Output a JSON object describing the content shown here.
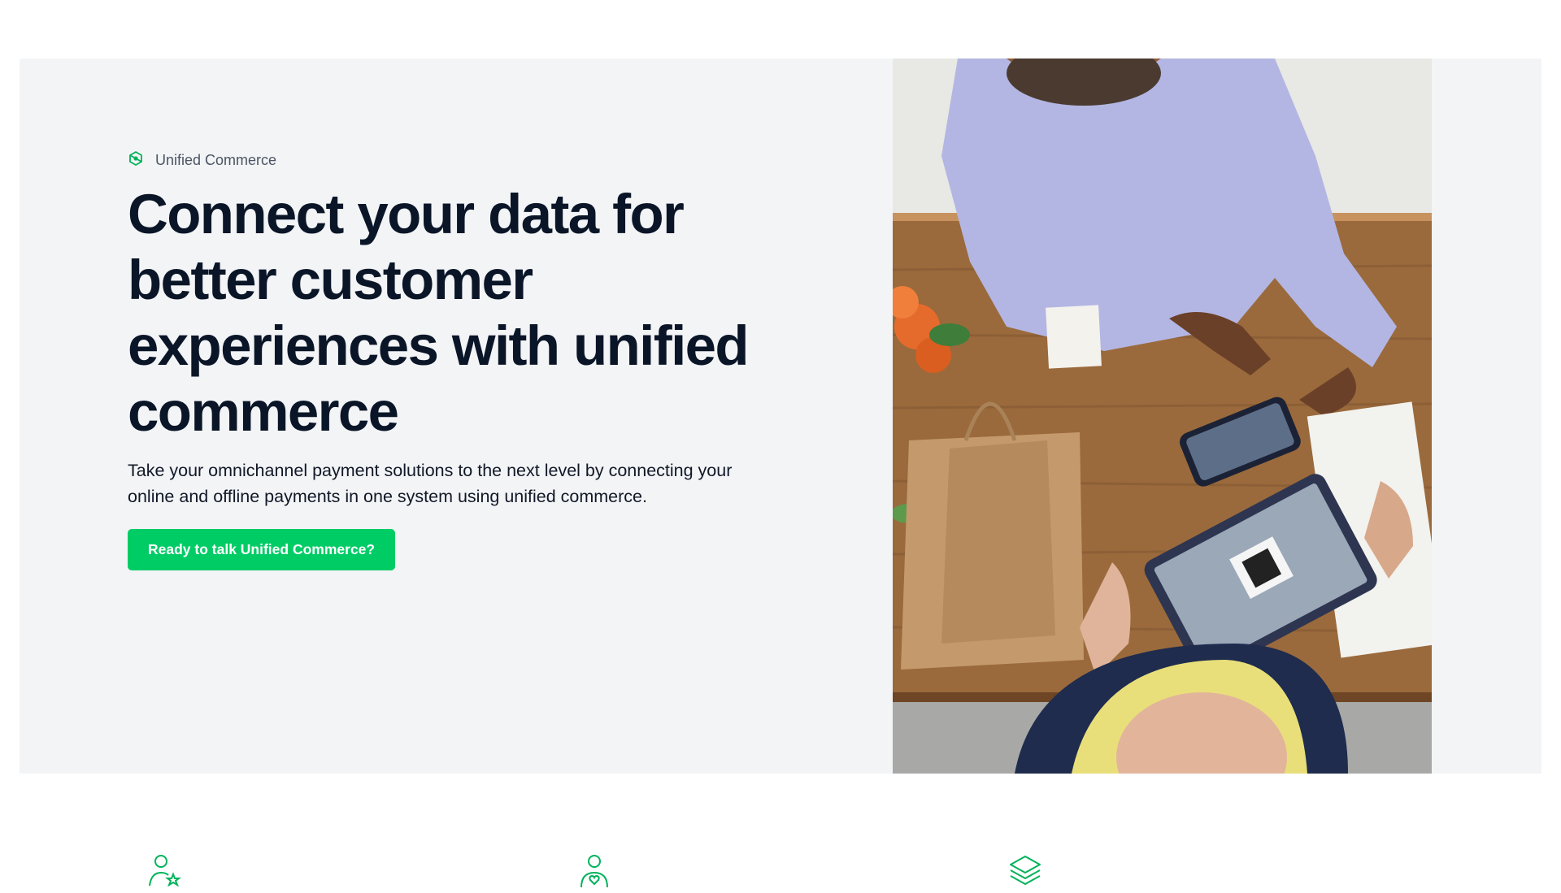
{
  "hero": {
    "eyebrow_icon": "unified-commerce-icon",
    "eyebrow_label": "Unified Commerce",
    "headline": "Connect your data for better customer experiences with unified commerce",
    "subtext": "Take your omnichannel payment solutions to the next level by connecting your online and offline payments in one system using unified commerce.",
    "cta_label": "Ready to talk Unified Commerce?",
    "image": "photo-checkout-tablet-payment"
  },
  "features": {
    "icons": [
      "user-star-icon",
      "user-heart-icon",
      "layers-icon"
    ]
  },
  "colors": {
    "accent": "#00cc66",
    "hero_background": "#f3f4f6",
    "headline": "#0a1628"
  }
}
